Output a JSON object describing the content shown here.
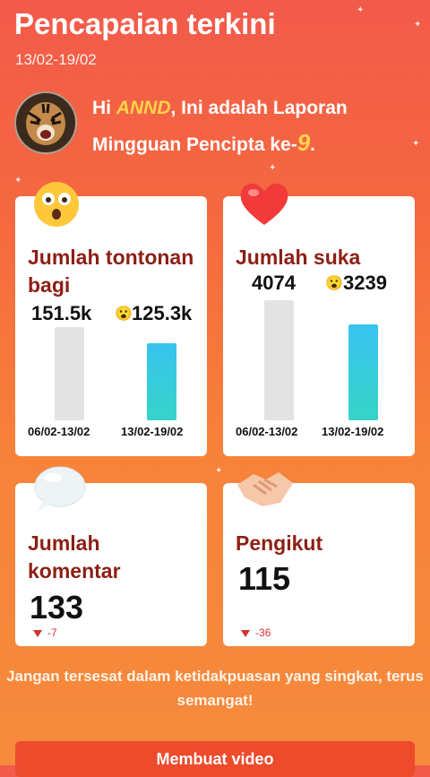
{
  "header": {
    "title": "Pencapaian terkini",
    "date_range": "13/02-19/02"
  },
  "greeting": {
    "prefix": "Hi ",
    "username": "ANND",
    "text_mid": ", Ini adalah Laporan Mingguan Pencipta ke-",
    "report_number": "9",
    "suffix": "."
  },
  "cards": {
    "views": {
      "label": "Jumlah tontonan bagi",
      "prev_value": "151.5k",
      "cur_value": "125.3k",
      "prev_range": "06/02-13/02",
      "cur_range": "13/02-19/02"
    },
    "likes": {
      "label": "Jumlah suka",
      "prev_value": "4074",
      "cur_value": "3239",
      "prev_range": "06/02-13/02",
      "cur_range": "13/02-19/02"
    },
    "comments": {
      "label": "Jumlah komentar",
      "value": "133",
      "delta": "-7"
    },
    "followers": {
      "label": "Pengikut",
      "value": "115",
      "delta": "-36"
    }
  },
  "chart_data": [
    {
      "type": "bar",
      "title": "Jumlah tontonan bagi",
      "categories": [
        "06/02-13/02",
        "13/02-19/02"
      ],
      "values": [
        151500,
        125300
      ]
    },
    {
      "type": "bar",
      "title": "Jumlah suka",
      "categories": [
        "06/02-13/02",
        "13/02-19/02"
      ],
      "values": [
        4074,
        3239
      ]
    }
  ],
  "motto": "Jangan tersesat dalam ketidakpuasan yang singkat, terus semangat!",
  "cta": {
    "label": "Membuat video"
  },
  "colors": {
    "accent_red": "#8c1f14",
    "bar_current": "#39c3ef",
    "bar_previous": "#e3e3e3",
    "negative": "#d43131"
  }
}
